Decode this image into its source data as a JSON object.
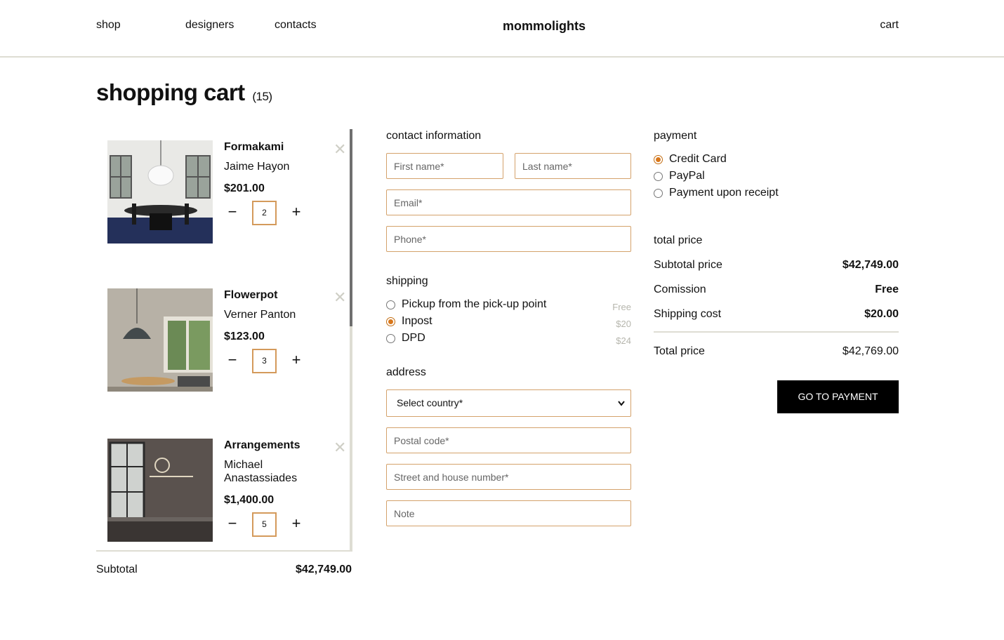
{
  "header": {
    "nav": [
      {
        "label": "shop"
      },
      {
        "label": "designers"
      },
      {
        "label": "contacts"
      }
    ],
    "brand": "mommolights",
    "cart_label": "cart"
  },
  "page": {
    "title": "shopping cart",
    "count": "(15)"
  },
  "cart": {
    "remove_icon": "close-icon",
    "minus_symbol": "−",
    "plus_symbol": "+",
    "remove_symbol": "✕",
    "items": [
      {
        "name": "Formakami",
        "designer": "Jaime Hayon",
        "price": "$201.00",
        "quantity": "2"
      },
      {
        "name": "Flowerpot",
        "designer": "Verner Panton",
        "price": "$123.00",
        "quantity": "3"
      },
      {
        "name": "Arrangements",
        "designer": "Michael Anastassiades",
        "price": "$1,400.00",
        "quantity": "5"
      }
    ],
    "subtotal_label": "Subtotal",
    "subtotal_value": "$42,749.00"
  },
  "contact": {
    "title": "contact information",
    "first_name_placeholder": "First name*",
    "last_name_placeholder": "Last name*",
    "email_placeholder": "Email*",
    "phone_placeholder": "Phone*"
  },
  "shipping": {
    "title": "shipping",
    "options": [
      {
        "label": "Pickup from the pick-up point",
        "price": "Free",
        "selected": false
      },
      {
        "label": "Inpost",
        "price": "$20",
        "selected": true
      },
      {
        "label": "DPD",
        "price": "$24",
        "selected": false
      }
    ]
  },
  "address": {
    "title": "address",
    "country_select": "Select country*",
    "postal_placeholder": "Postal code*",
    "street_placeholder": "Street and house number*",
    "note_placeholder": "Note"
  },
  "payment": {
    "title": "payment",
    "options": [
      {
        "label": "Credit Card",
        "selected": true
      },
      {
        "label": "PayPal",
        "selected": false
      },
      {
        "label": "Payment upon receipt",
        "selected": false
      }
    ]
  },
  "totals": {
    "title": "total price",
    "rows": [
      {
        "label": "Subtotal price",
        "value": "$42,749.00"
      },
      {
        "label": "Comission",
        "value": "Free"
      },
      {
        "label": "Shipping cost",
        "value": "$20.00"
      }
    ],
    "total_label": "Total price",
    "total_value": "$42,769.00",
    "pay_button": "GO TO PAYMENT"
  },
  "colors": {
    "accent": "#d4a26b",
    "radio_selected": "#d9771a",
    "divider": "#deddd3",
    "button_bg": "#000000"
  }
}
